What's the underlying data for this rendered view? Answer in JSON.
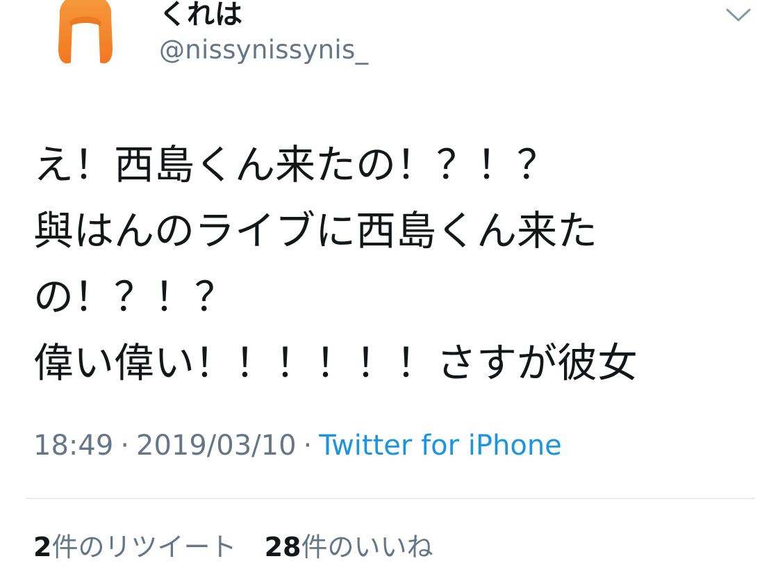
{
  "user": {
    "display_name": "くれは",
    "handle": "@nissynissynis_",
    "avatar_icon": "orange-bob-hair-avatar-icon"
  },
  "menu": {
    "icon": "chevron-down-icon"
  },
  "tweet": {
    "lines": [
      "え！西島くん来たの！？！？",
      "與はんのライブに西島くん来た",
      "の！？！？",
      "偉い偉い！！！！！！さすが彼女"
    ],
    "time": "18:49",
    "separator": "·",
    "date": "2019/03/10",
    "source": "Twitter for iPhone"
  },
  "stats": {
    "retweets_count": "2",
    "retweets_label": "件のリツイート",
    "likes_count": "28",
    "likes_label": "件のいいね"
  },
  "colors": {
    "text_primary": "#14171a",
    "text_secondary": "#657786",
    "link": "#1b95e0",
    "divider": "#e6ecf0",
    "avatar_orange": "#f5862a"
  }
}
